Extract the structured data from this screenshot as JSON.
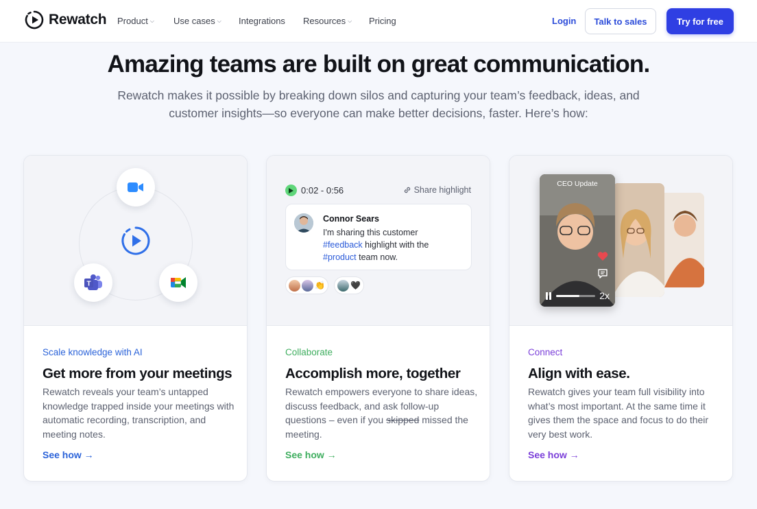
{
  "nav": {
    "brand": "Rewatch",
    "items": [
      {
        "label": "Product",
        "caret": true
      },
      {
        "label": "Use cases",
        "caret": true
      },
      {
        "label": "Integrations",
        "caret": false
      },
      {
        "label": "Resources",
        "caret": true
      },
      {
        "label": "Pricing",
        "caret": false
      }
    ],
    "login": "Login",
    "talk_to_sales": "Talk to sales",
    "try_for_free": "Try for free"
  },
  "hero": {
    "title": "Amazing teams are built on great communication.",
    "subtitle": "Rewatch makes it possible by breaking down silos and capturing your team’s feedback, ideas, and customer insights—so everyone can make better decisions, faster. Here’s how:"
  },
  "cards": [
    {
      "tag": "Scale knowledge with AI",
      "tag_color": "#2b63d9",
      "title": "Get more from your meetings",
      "desc": "Rewatch reveals your team’s untapped knowledge trapped inside your meetings with automatic recording, transcription, and meeting notes.",
      "link": "See how →",
      "icons": [
        "zoom-icon",
        "rewatch-icon",
        "teams-icon",
        "google-meet-icon"
      ]
    },
    {
      "tag": "Collaborate",
      "tag_color": "#3fae5f",
      "title": "Accomplish more, together",
      "desc_prefix": "Rewatch empowers everyone to share ideas, discuss feedback, and ask follow-up questions – even if you ",
      "desc_strike": "skipped",
      "desc_suffix": " missed the meeting.",
      "link": "See how →",
      "time_range": "0:02 - 0:56",
      "share_label": "Share highlight",
      "comment": {
        "author": "Connor Sears",
        "line1": "I'm sharing this customer",
        "hashtag1": "#feedback",
        "line2": " highlight with the",
        "hashtag2": "#product",
        "line3": " team now."
      },
      "reactions": [
        {
          "emoji": "👏"
        },
        {
          "emoji": "🖤"
        }
      ]
    },
    {
      "tag": "Connect",
      "tag_color": "#7b3fd9",
      "title": "Align with ease.",
      "desc": "Rewatch gives your team full visibility into what’s most important. At the same time it gives them the space and focus to do their very best work.",
      "link": "See how →",
      "video": {
        "label": "CEO Update",
        "speed": "2x",
        "progress": 0.6
      }
    }
  ]
}
